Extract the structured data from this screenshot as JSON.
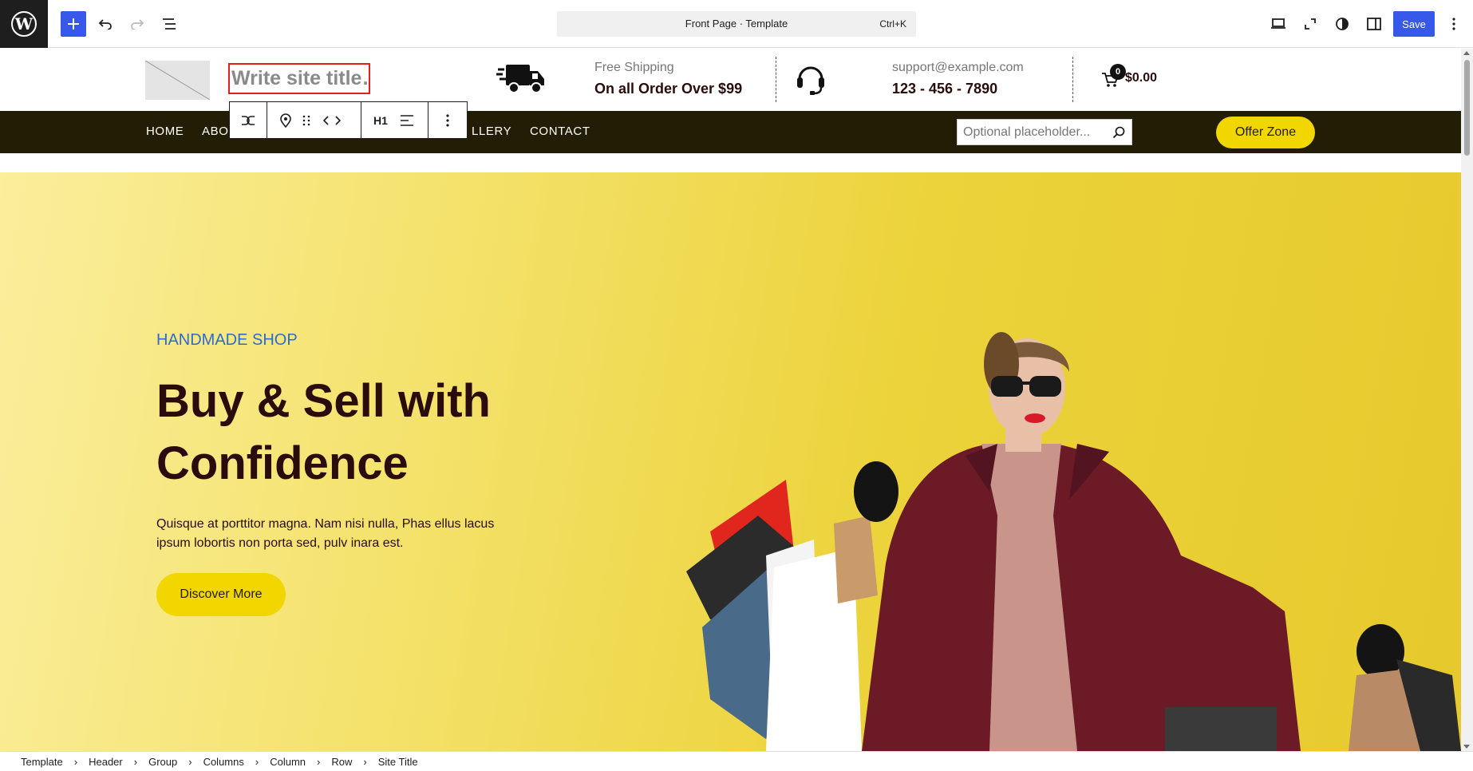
{
  "editor": {
    "document_title": "Front Page · Template",
    "shortcut": "Ctrl+K",
    "save_label": "Save",
    "icons": [
      "wordpress-icon",
      "plus-icon",
      "undo-icon",
      "redo-icon",
      "list-view-icon",
      "desktop-view-icon",
      "fullscreen-icon",
      "styles-icon",
      "settings-icon",
      "more-vertical-icon"
    ],
    "accent_color": "#3858e9"
  },
  "header": {
    "site_title_placeholder": "Write site title…",
    "shipping_label": "Free Shipping",
    "shipping_value": "On all Order Over $99",
    "support_email": "support@example.com",
    "support_phone": "123 - 456 - 7890",
    "cart_count": "0",
    "cart_total": "$0.00"
  },
  "nav": {
    "items": [
      "HOME",
      "ABO",
      "B",
      "LLERY",
      "CONTACT"
    ],
    "search_placeholder": "Optional placeholder...",
    "offer_button": "Offer Zone",
    "bar_color": "#231d06",
    "accent_color": "#f2d600"
  },
  "block_toolbar": {
    "heading_level": "H1",
    "icons": [
      "transform-icon",
      "location-icon",
      "drag-icon",
      "move-arrows-icon",
      "align-icon",
      "options-icon"
    ]
  },
  "hero": {
    "eyebrow": "HANDMADE SHOP",
    "title": "Buy & Sell with Confidence",
    "text": "Quisque at porttitor magna. Nam nisi nulla, Phas ellus lacus ipsum lobortis non porta sed, pulv inara est.",
    "button": "Discover More"
  },
  "breadcrumbs": [
    "Template",
    "Header",
    "Group",
    "Columns",
    "Column",
    "Row",
    "Site Title"
  ]
}
